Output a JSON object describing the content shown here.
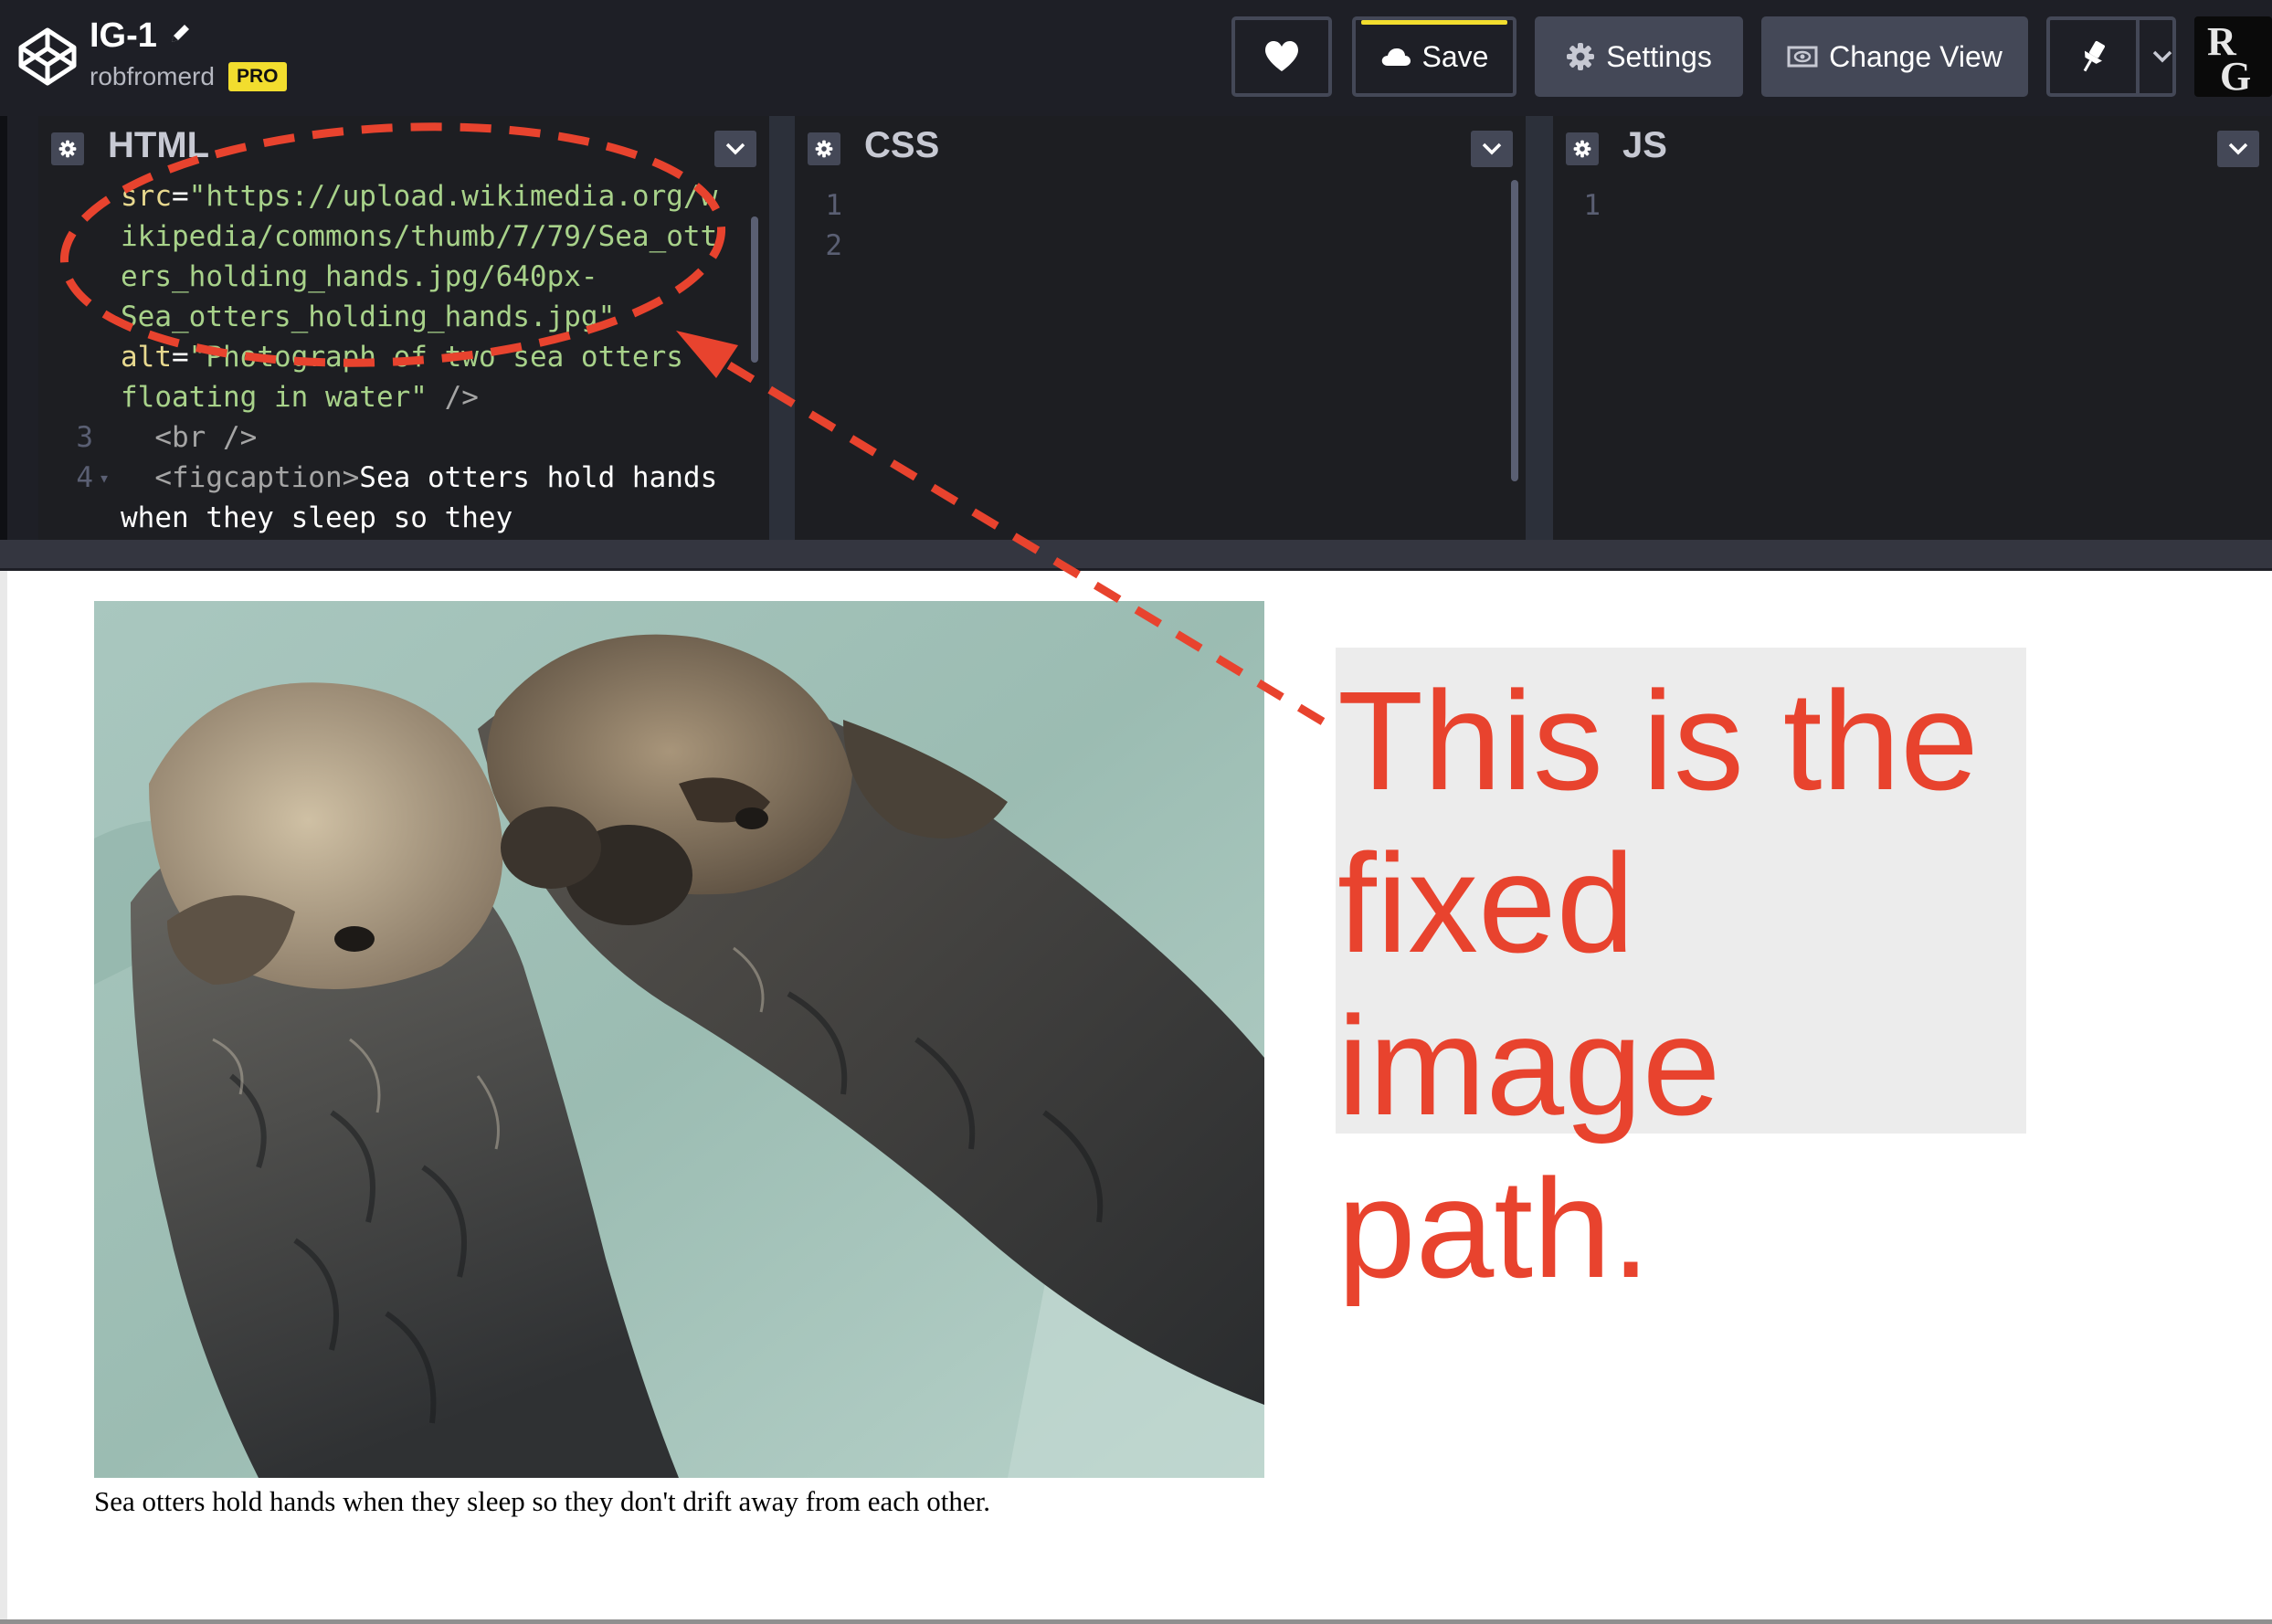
{
  "header": {
    "title": "IG-1",
    "username": "robfromerd",
    "pro_badge": "PRO",
    "buttons": {
      "save": "Save",
      "settings": "Settings",
      "change_view": "Change View"
    },
    "avatar_letters": [
      "R",
      "G"
    ]
  },
  "panes": {
    "html": {
      "title": "HTML",
      "lines": [
        {
          "num": "",
          "attr": "src",
          "eq": "=",
          "str": "\"https://upload.wikimedia.org/w",
          "plain": ""
        },
        {
          "num": "",
          "attr": "",
          "eq": "",
          "str": "ikipedia/commons/thumb/7/79/Sea_ott",
          "plain": ""
        },
        {
          "num": "",
          "attr": "",
          "eq": "",
          "str": "ers_holding_hands.jpg/640px-",
          "plain": ""
        },
        {
          "num": "",
          "attr": "",
          "eq": "",
          "str": "Sea_otters_holding_hands.jpg\"",
          "plain": ""
        },
        {
          "num": "",
          "attr": "alt",
          "eq": "=",
          "str": "\"Photograph of two sea otters",
          "plain": ""
        },
        {
          "num": "",
          "attr": "",
          "eq": "",
          "str": "floating in water\"",
          "plain": " />"
        },
        {
          "num": "3",
          "tag": "  <br />",
          "plain": ""
        },
        {
          "num": "4",
          "tag": "  <figcaption>",
          "plain": "Sea otters hold hands"
        },
        {
          "num": "",
          "tag": "",
          "plain": "when they sleep so they"
        }
      ]
    },
    "css": {
      "title": "CSS",
      "line_numbers": [
        "1",
        "2"
      ]
    },
    "js": {
      "title": "JS",
      "line_numbers": [
        "1"
      ]
    }
  },
  "preview": {
    "image_alt": "Photograph of two sea otters floating in water",
    "caption": "Sea otters hold hands when they sleep so they don't drift away from each other."
  },
  "annotation": {
    "text": "This is the fixed image path.",
    "color": "#e8432e"
  },
  "colors": {
    "header_bg": "#1e1f26",
    "button_bg": "#444857",
    "pro_yellow": "#f2dd2e",
    "code_string": "#a8d28a",
    "code_attr": "#e8d98f"
  }
}
